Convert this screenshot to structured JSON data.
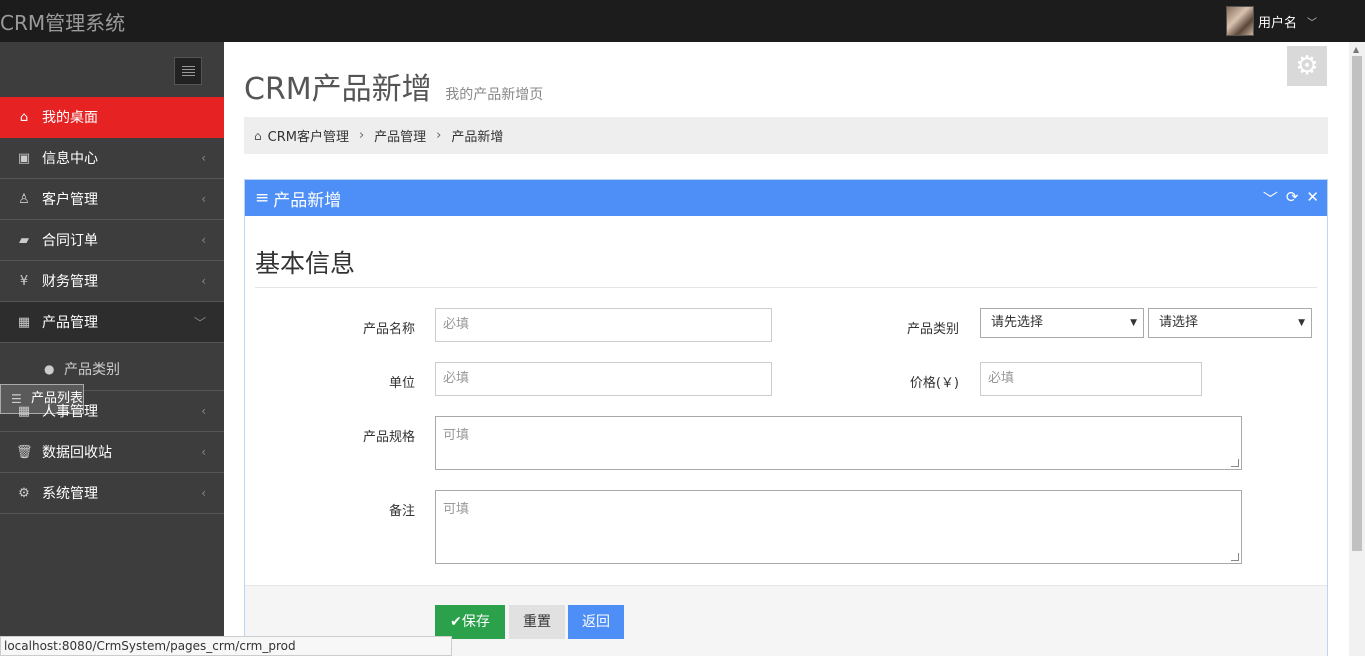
{
  "app": {
    "brand": "CRM管理系统"
  },
  "user": {
    "name": "用户名"
  },
  "sidebar": {
    "items": [
      {
        "label": "我的桌面",
        "icon": "home-icon",
        "glyph": "⌂"
      },
      {
        "label": "信息中心",
        "icon": "inbox-icon",
        "glyph": "▣"
      },
      {
        "label": "客户管理",
        "icon": "person-icon",
        "glyph": "♙"
      },
      {
        "label": "合同订单",
        "icon": "book-icon",
        "glyph": "▰"
      },
      {
        "label": "财务管理",
        "icon": "yen-icon",
        "glyph": "¥"
      },
      {
        "label": "产品管理",
        "icon": "table-icon",
        "glyph": "▦"
      },
      {
        "label": "人事管理",
        "icon": "table-icon",
        "glyph": "▦"
      },
      {
        "label": "数据回收站",
        "icon": "trash-icon",
        "glyph": "🗑"
      },
      {
        "label": "系统管理",
        "icon": "gear-icon",
        "glyph": "⚙"
      }
    ],
    "sub_items": [
      {
        "label": "产品类别",
        "icon": "circle-chevron-icon",
        "glyph": "●"
      },
      {
        "label": "产品列表",
        "icon": "list-icon",
        "glyph": "☰"
      }
    ]
  },
  "page": {
    "title": "CRM产品新增",
    "subtitle": "我的产品新增页"
  },
  "breadcrumb": {
    "items": [
      "CRM客户管理",
      "产品管理",
      "产品新增"
    ]
  },
  "panel": {
    "title": "产品新增"
  },
  "form": {
    "section_title": "基本信息",
    "name_label": "产品名称",
    "name_placeholder": "必填",
    "category_label": "产品类别",
    "category_first": "请先选择",
    "category_second": "请选择",
    "unit_label": "单位",
    "unit_placeholder": "必填",
    "price_label": "价格(￥)",
    "price_placeholder": "必填",
    "spec_label": "产品规格",
    "spec_placeholder": "可填",
    "remark_label": "备注",
    "remark_placeholder": "可填"
  },
  "buttons": {
    "save": "保存",
    "reset": "重置",
    "back": "返回"
  },
  "status_bar": {
    "url": "localhost:8080/CrmSystem/pages_crm/crm_prod"
  },
  "colors": {
    "active": "#e62223",
    "primary": "#4e8ef7",
    "success": "#2aa14a"
  }
}
